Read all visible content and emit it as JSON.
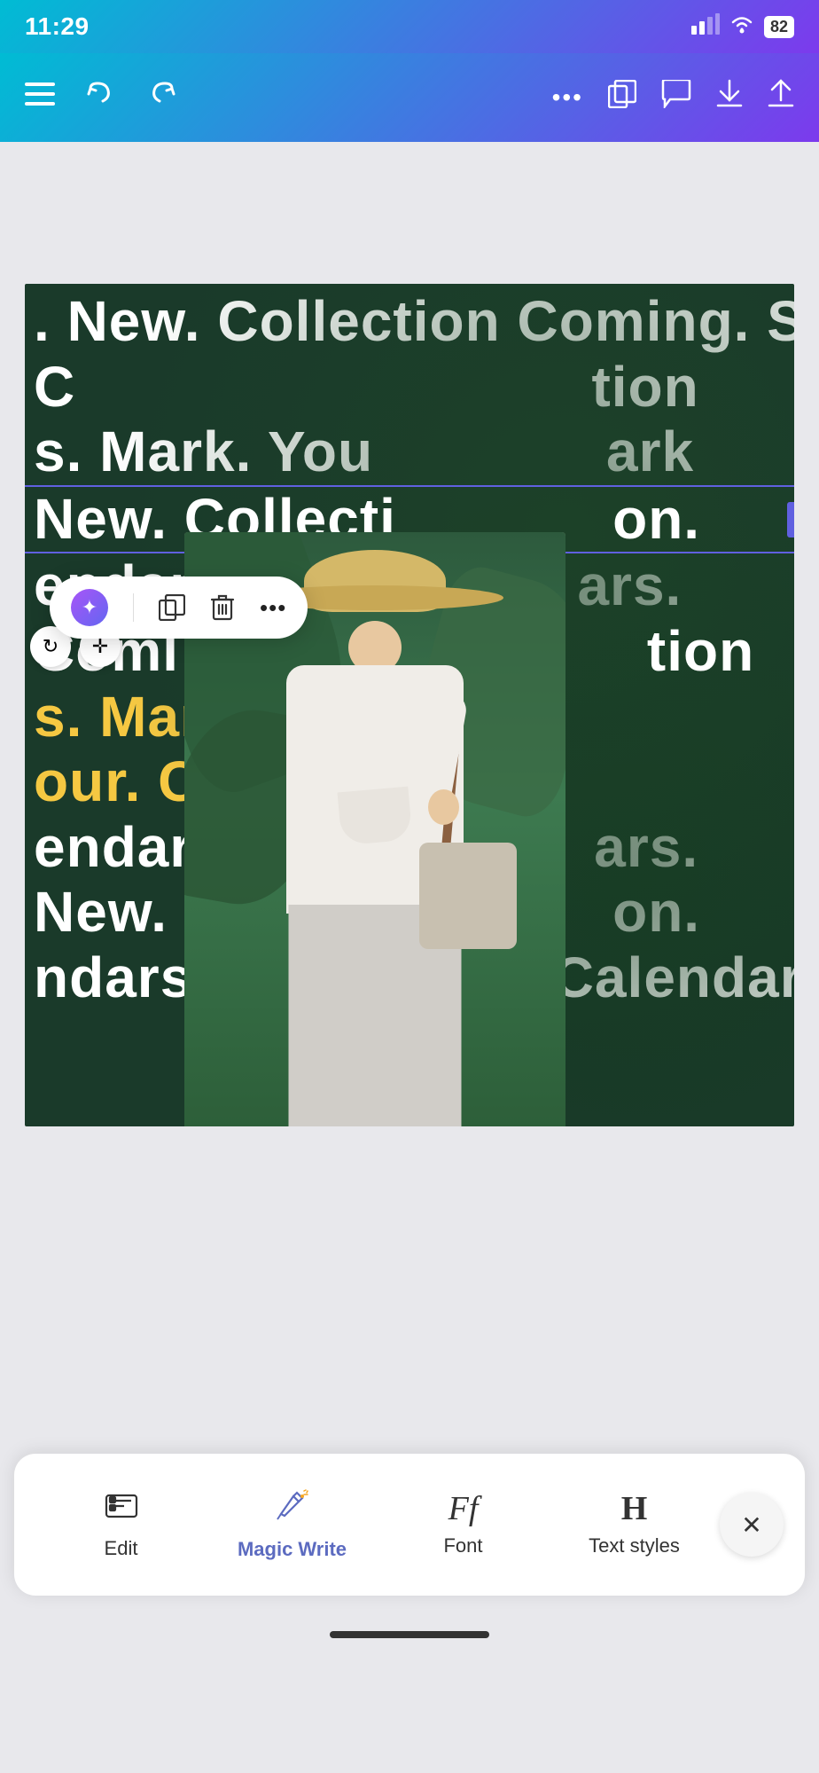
{
  "statusBar": {
    "time": "11:29",
    "batteryLevel": "82",
    "signalBars": "▂▄▆",
    "wifi": "wifi"
  },
  "toolbar": {
    "menuIcon": "☰",
    "undoIcon": "↩",
    "redoIcon": "↪",
    "moreIcon": "•••",
    "duplicateIcon": "⧉",
    "commentIcon": "💬",
    "downloadIcon": "⬇",
    "shareIcon": "⬆"
  },
  "canvas": {
    "textLines": [
      ". New. Collection Coming. Soo",
      "C                                               tion",
      "s. Mark. You                              ark",
      "New. Collecti                            on.",
      "endars. Mark                            ars.",
      "Coml  g.Goo                             tion",
      "s. Mark. Your.",
      "our. Calendars.",
      "endars. Mark                            ars.",
      "New. Collecti                           on.",
      "ndars. Mark. Your. Calendars."
    ],
    "yellowLines": [
      "s. Mark. Your.",
      "our. Calendars."
    ]
  },
  "contextMenu": {
    "aiIcon": "✦",
    "copyIcon": "⧉",
    "deleteIcon": "🗑",
    "moreIcon": "•••"
  },
  "bottomToolbar": {
    "tools": [
      {
        "id": "edit",
        "label": "Edit",
        "icon": "⌨"
      },
      {
        "id": "magic-write",
        "label": "Magic Write",
        "icon": "✨",
        "active": true
      },
      {
        "id": "font",
        "label": "Font",
        "icon": "Ff"
      },
      {
        "id": "text-styles",
        "label": "Text styles",
        "icon": "H"
      }
    ],
    "closeIcon": "✕"
  }
}
